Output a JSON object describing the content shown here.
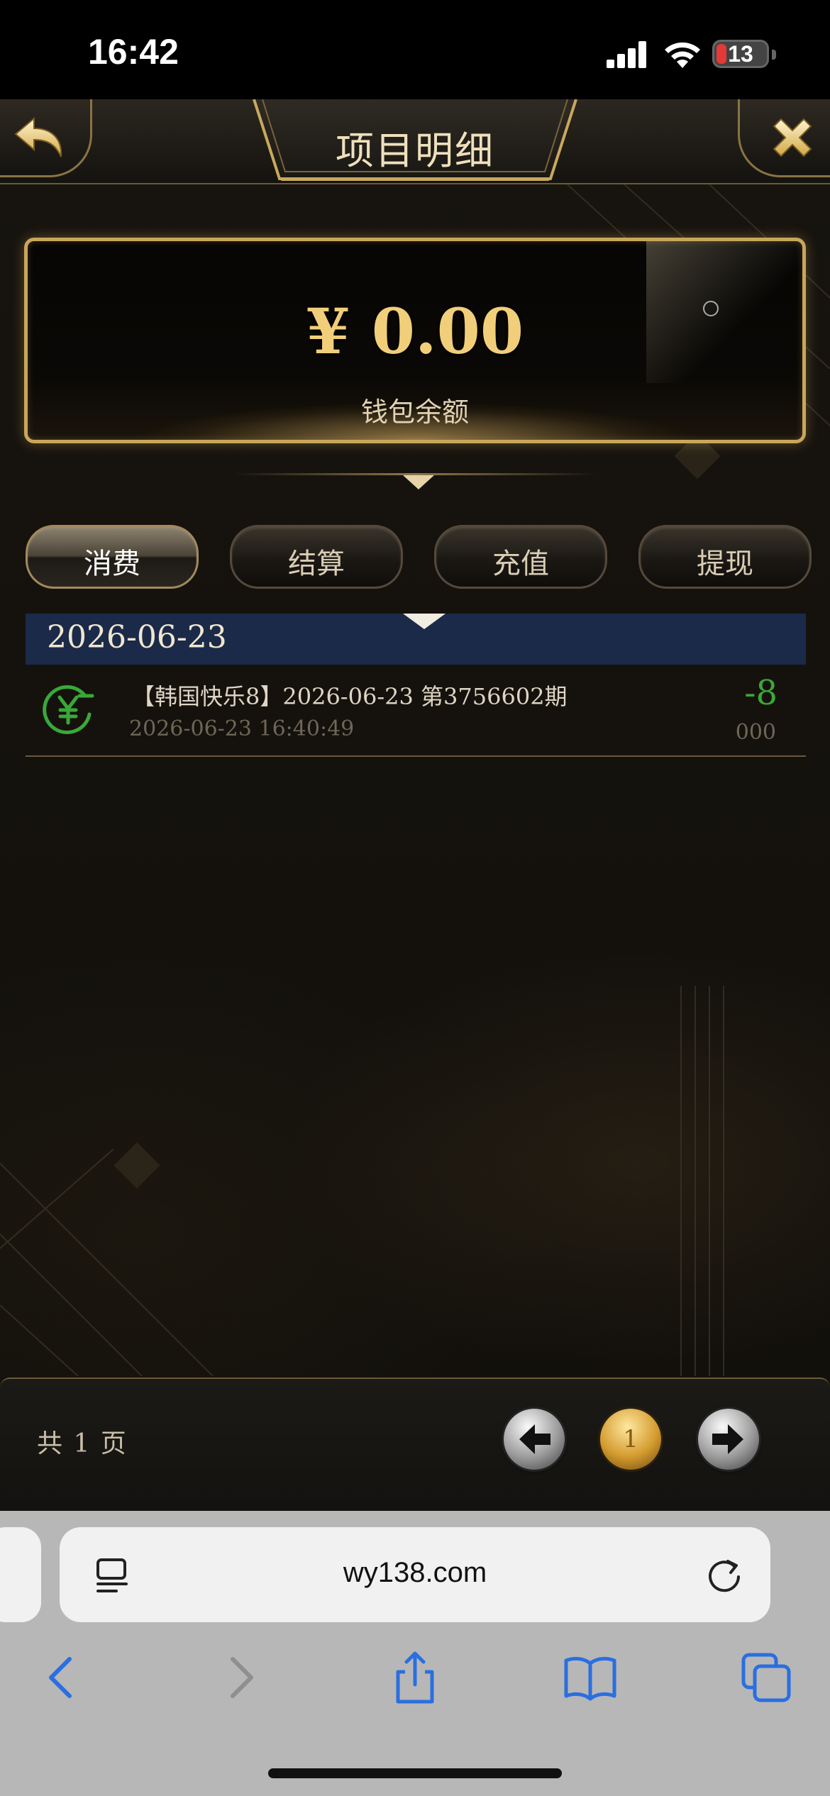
{
  "status_bar": {
    "time": "16:42",
    "battery": "13"
  },
  "header": {
    "title": "项目明细",
    "back_icon": "back-arrow-icon",
    "close_icon": "close-icon"
  },
  "balance": {
    "amount": "¥ 0.00",
    "label": "钱包余额"
  },
  "tabs": [
    {
      "label": "消费",
      "active": true
    },
    {
      "label": "结算",
      "active": false
    },
    {
      "label": "充值",
      "active": false
    },
    {
      "label": "提现",
      "active": false
    }
  ],
  "records": {
    "date": "2026-06-23",
    "items": [
      {
        "title": "【韩国快乐8】2026-06-23 第3756602期",
        "time": "2026-06-23 16:40:49",
        "amount": "-8",
        "sub": "000",
        "icon": "yuan-coin-icon"
      }
    ]
  },
  "pager": {
    "total": "共 1 页",
    "current_page": "1"
  },
  "browser": {
    "url": "wy138.com"
  },
  "colors": {
    "accent_gold": "#c9a65a",
    "amount_green": "#3aa838",
    "date_bar": "#1b2a49"
  }
}
